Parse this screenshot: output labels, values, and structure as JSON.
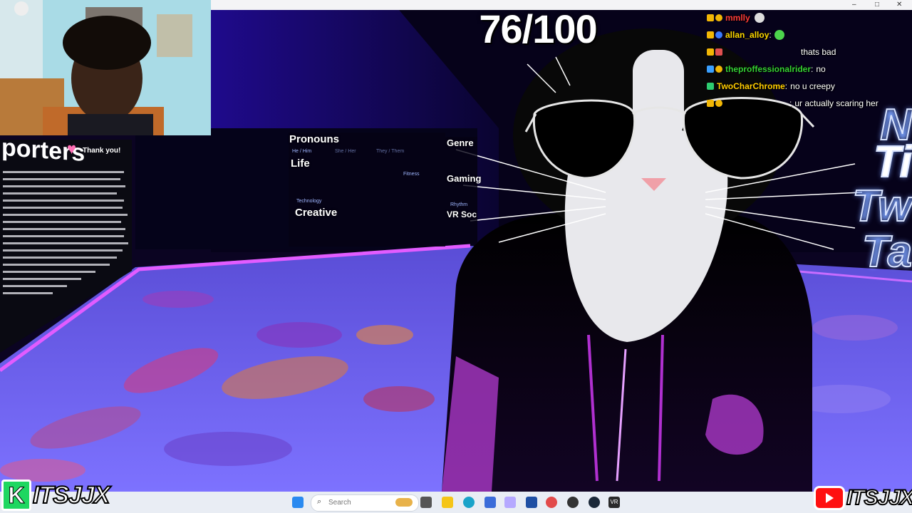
{
  "score": "76/100",
  "window_controls": [
    "–",
    "□",
    "✕"
  ],
  "chat": [
    {
      "user": "mmlly",
      "color": "#ff3b3b",
      "message": "",
      "badges": [
        "#f2b705",
        "#f2b705"
      ],
      "emote": "ghost"
    },
    {
      "user": "allan_alloy",
      "color": "#ffd700",
      "message": "",
      "badges": [
        "#f2b705",
        "#3a7bff"
      ],
      "emote": "frog"
    },
    {
      "user": "",
      "color": "#ff2a2a",
      "message": "thats bad",
      "badges": [
        "#f2b705",
        "#e05050"
      ]
    },
    {
      "user": "theproffessionalrider",
      "color": "#35d135",
      "message": "no",
      "badges": [
        "#3aa0ff",
        "#f2b705"
      ]
    },
    {
      "user": "TwoCharChrome",
      "color": "#ffcc00",
      "message": "no u creepy",
      "badges": [
        "#2ecc71"
      ]
    },
    {
      "user": "",
      "color": "#ff2a2a",
      "message": "ur actually scaring her",
      "badges": [
        "#f2b705",
        "#f2b705"
      ]
    }
  ],
  "supporters_wall": {
    "title": "porters",
    "thank_you": "Thank you!"
  },
  "info_board": {
    "pronouns": "Pronouns",
    "pronoun_tags": [
      "He / Him",
      "She / Her",
      "They / Them"
    ],
    "life": "Life",
    "life_tags": [
      "Fitness",
      "Technology"
    ],
    "creative": "Creative",
    "genre": "Genre",
    "gaming": "Gaming",
    "gaming_tags": [
      "Rhythm"
    ],
    "vr_social": "VR Soc"
  },
  "neon_sign": [
    "N",
    "Ti",
    "Tw",
    "Ta"
  ],
  "taskbar": {
    "search_placeholder": "Search",
    "tray_icon": "VR"
  },
  "branding": {
    "left": "ITSJJX",
    "left_badge": "K",
    "right": "ITSJJX"
  }
}
